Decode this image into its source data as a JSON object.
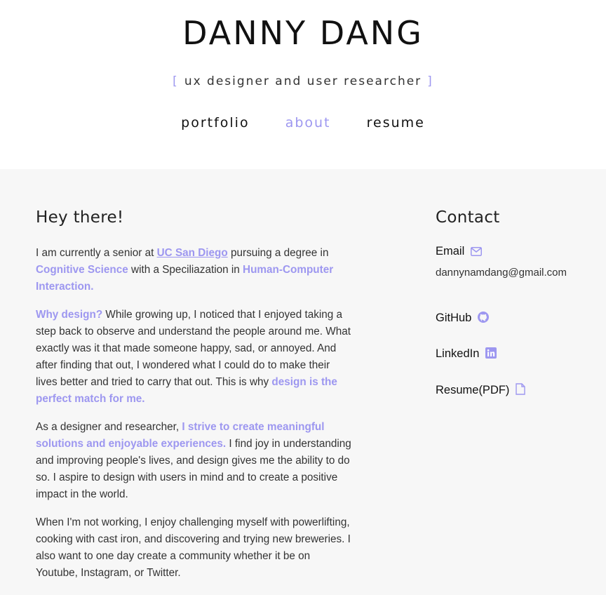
{
  "header": {
    "name": "DANNY DANG",
    "tagline_open": "[",
    "tagline": "ux designer and user researcher",
    "tagline_close": "]",
    "nav": [
      {
        "label": "portfolio",
        "active": false
      },
      {
        "label": "about",
        "active": true
      },
      {
        "label": "resume",
        "active": false
      }
    ]
  },
  "about": {
    "heading": "Hey there!",
    "p1": {
      "a": "I am currently a senior at ",
      "b": "UC San Diego",
      "c": " pursuing a degree in ",
      "d": "Cognitive Science",
      "e": " with a Speciliazation in ",
      "f": "Human-Computer Interaction."
    },
    "p2": {
      "a": "Why design?",
      "b": " While growing up, I noticed that I enjoyed taking a step back to observe and understand the people around me. What exactly was it that made someone happy, sad, or annoyed. And after finding that out, I wondered what I could do to make their lives better and tried to carry that out. This is why ",
      "c": "design is the perfect match for me."
    },
    "p3": {
      "a": "As a designer and researcher, ",
      "b": "I strive to create meaningful solutions and enjoyable experiences.",
      "c": " I find joy in understanding and improving people's lives, and design gives me the ability to do so. I aspire to design with users in mind and to create a positive impact in the world."
    },
    "p4": "When I'm not working, I enjoy challenging myself with powerlifting, cooking with cast iron, and discovering and trying new breweries. I also want to one day create a community whether it be on Youtube, Instagram, or Twitter."
  },
  "contact": {
    "heading": "Contact",
    "email_label": "Email",
    "email_value": "dannynamdang@gmail.com",
    "github_label": "GitHub",
    "linkedin_label": "LinkedIn",
    "resume_label": "Resume(PDF)",
    "icons": [
      "envelope-icon",
      "github-icon",
      "linkedin-icon",
      "file-icon"
    ]
  },
  "colors": {
    "accent": "#9d97f0",
    "main_bg": "#f7f7f7"
  }
}
